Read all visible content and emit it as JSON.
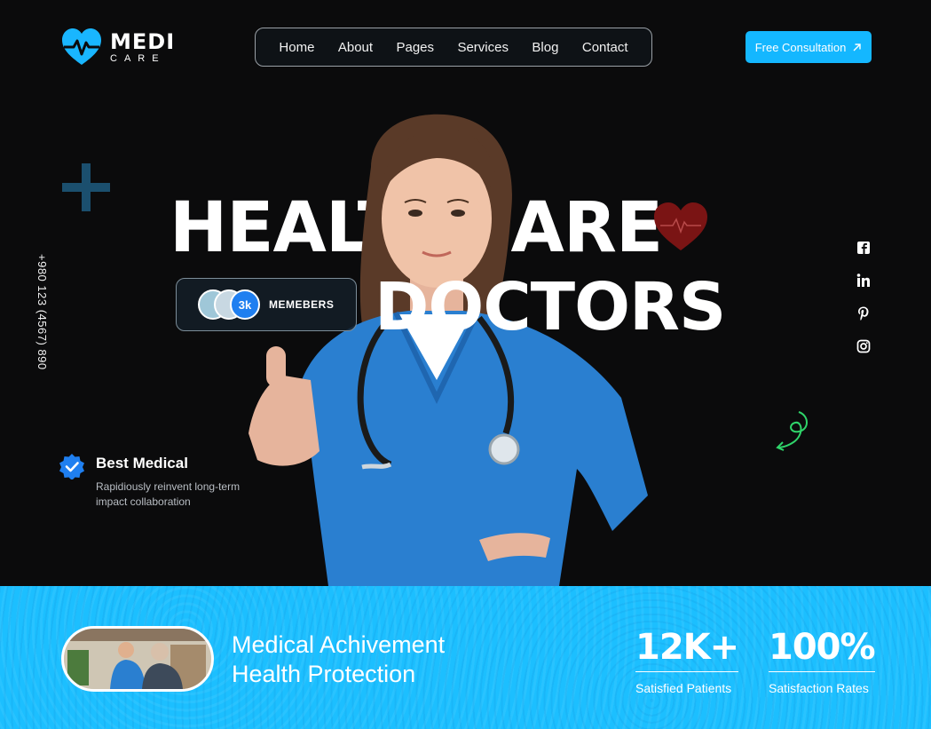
{
  "brand": {
    "name_line1": "MEDI",
    "name_line2": "CARE"
  },
  "nav": {
    "items": [
      "Home",
      "About",
      "Pages",
      "Services",
      "Blog",
      "Contact"
    ]
  },
  "cta": {
    "label": "Free Consultation",
    "icon": "arrow-up-right-icon"
  },
  "hero": {
    "headline_line1": "HEALTHCARE",
    "headline_line2": "DOCTORS",
    "phone": "+980 123 (4567) 890",
    "members": {
      "count": "3k",
      "label": "MEMEBERS"
    },
    "feature": {
      "title": "Best Medical",
      "description": "Rapidiously reinvent long-term impact collaboration",
      "icon": "verified-badge-icon"
    },
    "social": [
      "facebook-icon",
      "linkedin-icon",
      "pinterest-icon",
      "instagram-icon"
    ]
  },
  "band": {
    "title_line1": "Medical Achivement",
    "title_line2": "Health Protection",
    "stats": [
      {
        "value": "12K+",
        "label": "Satisfied Patients"
      },
      {
        "value": "100%",
        "label": "Satisfaction Rates"
      }
    ]
  },
  "colors": {
    "background": "#0b0b0c",
    "accent": "#14b7ff",
    "band": "#1cbfff",
    "scrubs": "#2a7fd0"
  }
}
